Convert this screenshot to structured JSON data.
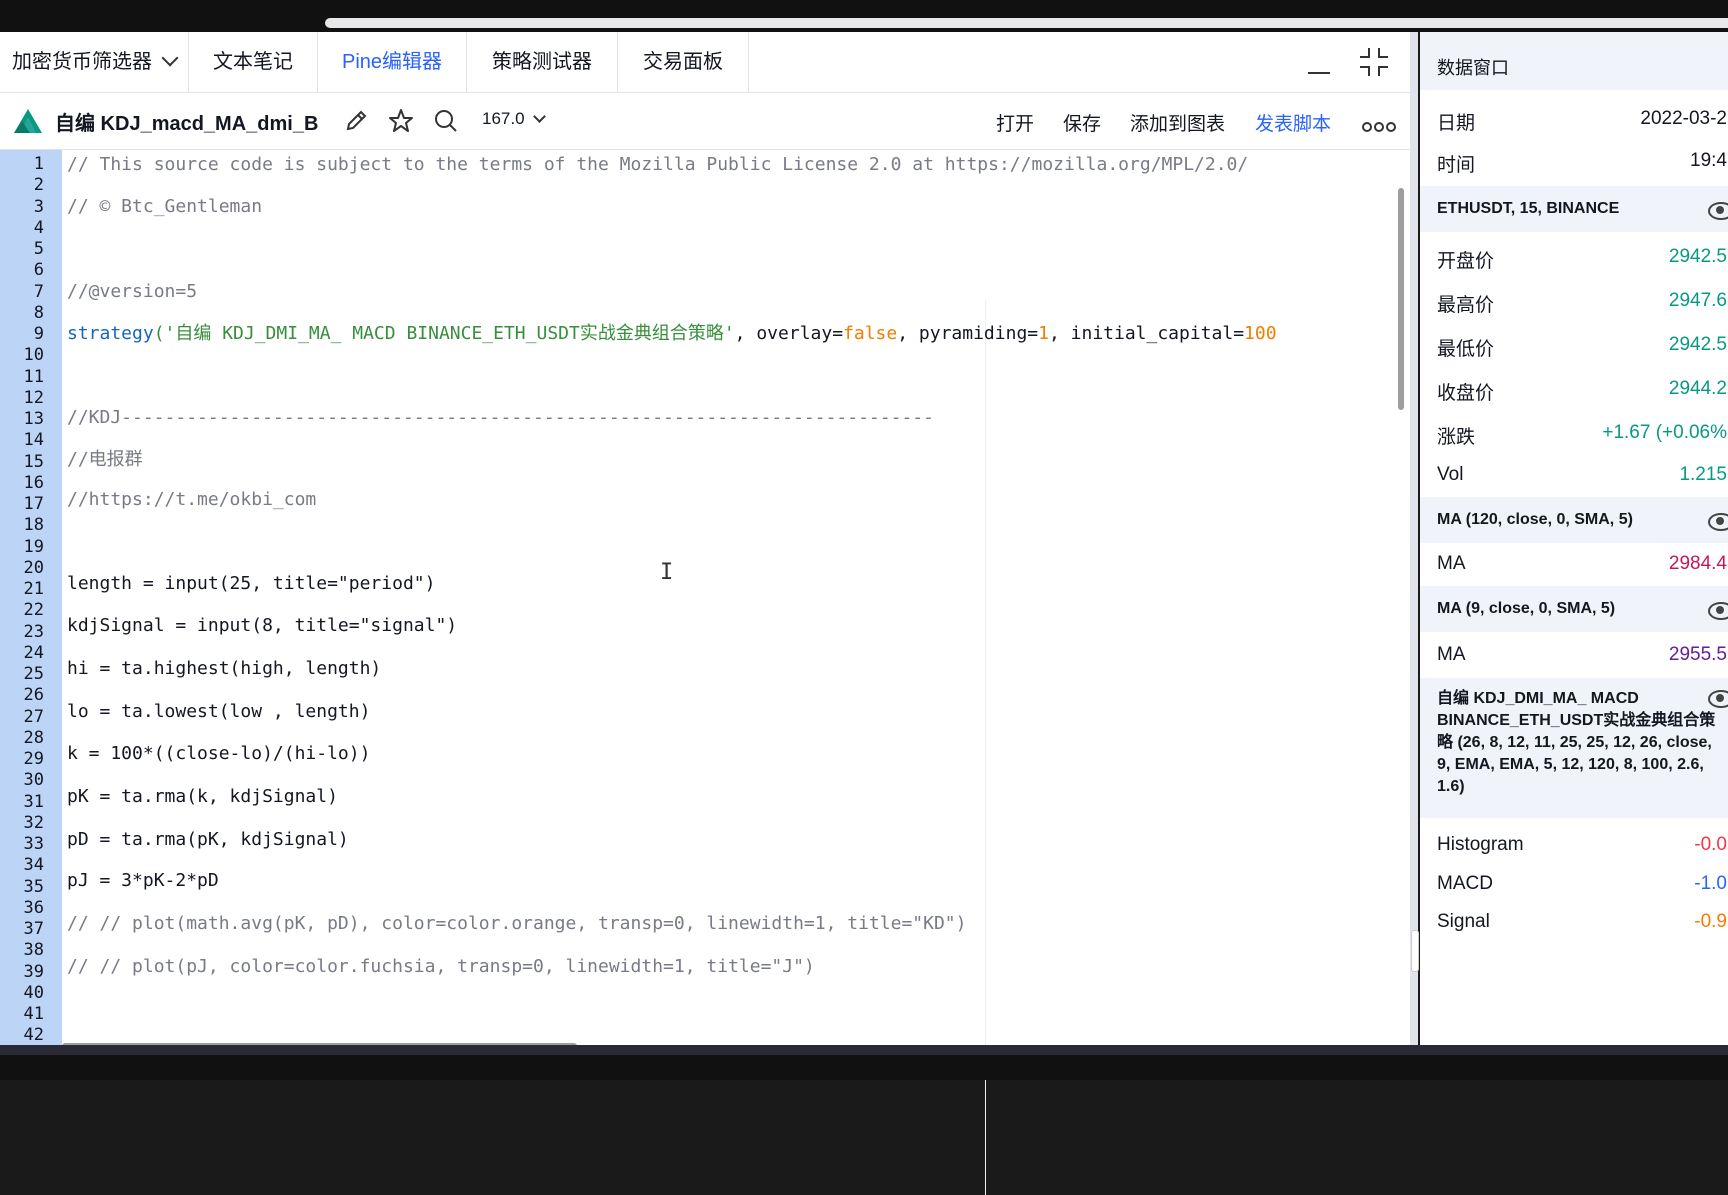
{
  "tabs": [
    {
      "label": "加密货币筛选器"
    },
    {
      "label": "文本笔记"
    },
    {
      "label": "Pine编辑器"
    },
    {
      "label": "策略测试器"
    },
    {
      "label": "交易面板"
    }
  ],
  "toolbar": {
    "script_name": "自编 KDJ_macd_MA_dmi_B",
    "version": "167.0",
    "open_label": "打开",
    "save_label": "保存",
    "add_to_chart_label": "添加到图表",
    "publish_label": "发表脚本"
  },
  "line_numbers": [
    "1",
    "2",
    "3",
    "4",
    "5",
    "6",
    "7",
    "8",
    "9",
    "10",
    "11",
    "12",
    "13",
    "14",
    "15",
    "16",
    "17",
    "18",
    "19",
    "20",
    "21",
    "22",
    "23",
    "24",
    "25",
    "26",
    "27",
    "28",
    "29",
    "30",
    "31",
    "32",
    "33",
    "34",
    "35",
    "36",
    "37",
    "38",
    "39",
    "40",
    "41",
    "42"
  ],
  "code": {
    "l1": "// This source code is subject to the terms of the Mozilla Public License 2.0 at https://mozilla.org/MPL/2.0/",
    "l3": "// © Btc_Gentleman",
    "l7": "//@version=5",
    "l9_kw": "strategy",
    "l9_str": "('自编 KDJ_DMI_MA_ MACD BINANCE_ETH_USDT实战金典组合策略'",
    "l9_a": ", overlay=",
    "l9_false": "false",
    "l9_b": ", pyramiding=",
    "l9_one": "1",
    "l9_c": ", initial_capital=",
    "l9_num": "100",
    "l13": "//KDJ---------------------------------------------------------------------------",
    "l15": "//电报群",
    "l17": "//https://t.me/okbi_com",
    "l21": "length = input(25, title=\"period\")",
    "l23": "kdjSignal = input(8, title=\"signal\")",
    "l25": "hi = ta.highest(high, length)",
    "l27": "lo = ta.lowest(low , length)",
    "l29": "k = 100*((close-lo)/(hi-lo))",
    "l31": "pK = ta.rma(k, kdjSignal)",
    "l33": "pD = ta.rma(pK, kdjSignal)",
    "l35": "pJ = 3*pK-2*pD",
    "l37": "// // plot(math.avg(pK, pD), color=color.orange, transp=0, linewidth=1, title=\"KD\")",
    "l39": "// // plot(pJ, color=color.fuchsia, transp=0, linewidth=1, title=\"J\")"
  },
  "data_window": {
    "title": "数据窗口",
    "date_label": "日期",
    "date_value": "2022-03-2",
    "time_label": "时间",
    "time_value": "19:4",
    "symbol_header": "ETHUSDT, 15, BINANCE",
    "open_label": "开盘价",
    "open_value": "2942.5",
    "high_label": "最高价",
    "high_value": "2947.6",
    "low_label": "最低价",
    "low_value": "2942.5",
    "close_label": "收盘价",
    "close_value": "2944.2",
    "change_label": "涨跌",
    "change_value": "+1.67 (+0.06%",
    "vol_label": "Vol",
    "vol_value": "1.215",
    "ma1_header": "MA (120, close, 0, SMA, 5)",
    "ma1_label": "MA",
    "ma1_value": "2984.4",
    "ma2_header": "MA (9, close, 0, SMA, 5)",
    "ma2_label": "MA",
    "ma2_value": "2955.5",
    "strategy_header": "自编 KDJ_DMI_MA_ MACD BINANCE_ETH_USDT实战金典组合策略 (26, 8, 12, 11, 25, 25, 12, 26, close, 9, EMA, EMA, 5, 12, 120, 8, 100, 2.6, 1.6)",
    "hist_label": "Histogram",
    "hist_value": "-0.0",
    "macd_label": "MACD",
    "macd_value": "-1.0",
    "signal_label": "Signal",
    "signal_value": "-0.9"
  },
  "colors": {
    "accent": "#2962ff",
    "gutter": "#bcd4f6",
    "positive": "#089981",
    "ma1": "#c2185b",
    "ma2": "#6a1b9a"
  },
  "icons": [
    "chevron-down-icon",
    "minimize-icon",
    "collapse-icon",
    "pine-logo-icon",
    "pencil-icon",
    "star-icon",
    "search-icon",
    "more-icon",
    "eye-icon"
  ]
}
